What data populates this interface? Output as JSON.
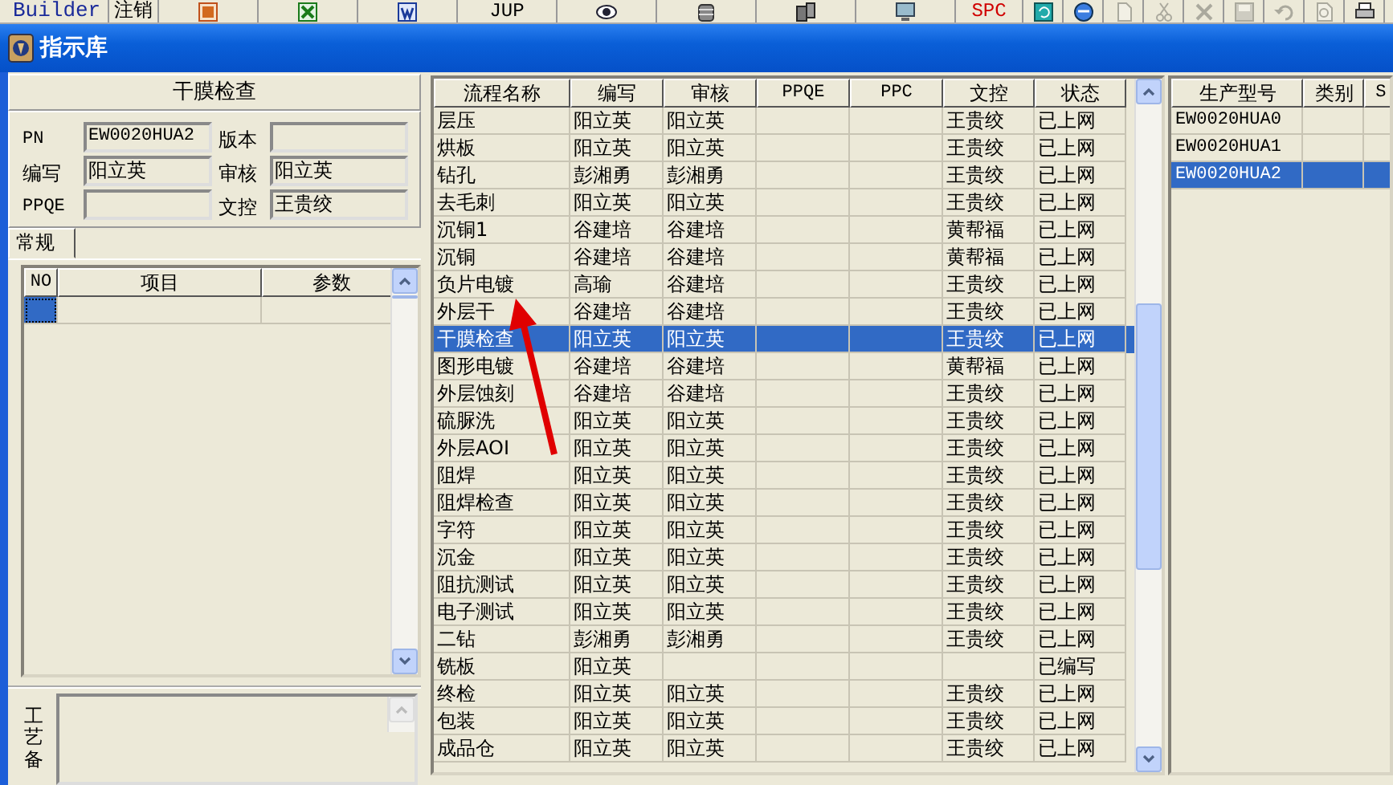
{
  "toolbar": [
    {
      "kind": "text",
      "label": "Builder",
      "disabled": false
    },
    {
      "kind": "text",
      "label": "注销",
      "disabled": false
    },
    {
      "kind": "icon",
      "disabled": false
    },
    {
      "kind": "icon",
      "disabled": false
    },
    {
      "kind": "icon",
      "disabled": false
    },
    {
      "kind": "text",
      "label": "JUP",
      "disabled": false
    },
    {
      "kind": "icon",
      "disabled": false
    },
    {
      "kind": "icon",
      "disabled": false
    },
    {
      "kind": "icon",
      "disabled": false
    },
    {
      "kind": "icon",
      "disabled": false
    },
    {
      "kind": "text",
      "label": "SPC",
      "disabled": false
    },
    {
      "kind": "icon",
      "disabled": false
    },
    {
      "kind": "icon",
      "disabled": false
    },
    {
      "kind": "icon",
      "disabled": true
    },
    {
      "kind": "icon",
      "disabled": true
    },
    {
      "kind": "icon",
      "disabled": true
    },
    {
      "kind": "icon",
      "disabled": true
    },
    {
      "kind": "icon",
      "disabled": true
    },
    {
      "kind": "icon",
      "disabled": true
    },
    {
      "kind": "icon",
      "disabled": false
    }
  ],
  "window": {
    "title": "指示库"
  },
  "detail": {
    "heading": "干膜检查",
    "fields": [
      {
        "label": "PN",
        "value": "EW0020HUA2"
      },
      {
        "label": "版本"
      },
      {
        "label": "编写",
        "value": "阳立英"
      },
      {
        "label": "审核",
        "value": "阳立英"
      },
      {
        "label": "PPQE"
      },
      {
        "label": "文控",
        "value": "王贵绞"
      }
    ],
    "tabs": [
      {
        "label": "常规",
        "selected": true
      }
    ],
    "params_table": {
      "columns": [
        "NO",
        "项目",
        "参数"
      ],
      "rows": [
        {
          "selected": true
        }
      ]
    },
    "notes": {
      "label": "工艺备"
    }
  },
  "process_table": {
    "columns": [
      "流程名称",
      "编写",
      "审核",
      "PPQE",
      "PPC",
      "文控",
      "状态"
    ],
    "rows": [
      {
        "cells": [
          "层压",
          "阳立英",
          "阳立英",
          null,
          null,
          "王贵绞",
          "已上网"
        ],
        "selected": false
      },
      {
        "cells": [
          "烘板",
          "阳立英",
          "阳立英",
          null,
          null,
          "王贵绞",
          "已上网"
        ],
        "selected": false
      },
      {
        "cells": [
          "钻孔",
          "彭湘勇",
          "彭湘勇",
          null,
          null,
          "王贵绞",
          "已上网"
        ],
        "selected": false
      },
      {
        "cells": [
          "去毛刺",
          "阳立英",
          "阳立英",
          null,
          null,
          "王贵绞",
          "已上网"
        ],
        "selected": false
      },
      {
        "cells": [
          "沉铜1",
          "谷建培",
          "谷建培",
          null,
          null,
          "黄帮福",
          "已上网"
        ],
        "selected": false
      },
      {
        "cells": [
          "沉铜",
          "谷建培",
          "谷建培",
          null,
          null,
          "黄帮福",
          "已上网"
        ],
        "selected": false
      },
      {
        "cells": [
          "负片电镀",
          "高瑜",
          "谷建培",
          null,
          null,
          "王贵绞",
          "已上网"
        ],
        "selected": false
      },
      {
        "cells": [
          "外层干",
          "谷建培",
          "谷建培",
          null,
          null,
          "王贵绞",
          "已上网"
        ],
        "selected": false
      },
      {
        "cells": [
          "干膜检查",
          "阳立英",
          "阳立英",
          null,
          null,
          "王贵绞",
          "已上网"
        ],
        "selected": true
      },
      {
        "cells": [
          "图形电镀",
          "谷建培",
          "谷建培",
          null,
          null,
          "黄帮福",
          "已上网"
        ],
        "selected": false
      },
      {
        "cells": [
          "外层蚀刻",
          "谷建培",
          "谷建培",
          null,
          null,
          "王贵绞",
          "已上网"
        ],
        "selected": false
      },
      {
        "cells": [
          "硫脲洗",
          "阳立英",
          "阳立英",
          null,
          null,
          "王贵绞",
          "已上网"
        ],
        "selected": false
      },
      {
        "cells": [
          "外层AOI",
          "阳立英",
          "阳立英",
          null,
          null,
          "王贵绞",
          "已上网"
        ],
        "selected": false
      },
      {
        "cells": [
          "阻焊",
          "阳立英",
          "阳立英",
          null,
          null,
          "王贵绞",
          "已上网"
        ],
        "selected": false
      },
      {
        "cells": [
          "阻焊检查",
          "阳立英",
          "阳立英",
          null,
          null,
          "王贵绞",
          "已上网"
        ],
        "selected": false
      },
      {
        "cells": [
          "字符",
          "阳立英",
          "阳立英",
          null,
          null,
          "王贵绞",
          "已上网"
        ],
        "selected": false
      },
      {
        "cells": [
          "沉金",
          "阳立英",
          "阳立英",
          null,
          null,
          "王贵绞",
          "已上网"
        ],
        "selected": false
      },
      {
        "cells": [
          "阻抗测试",
          "阳立英",
          "阳立英",
          null,
          null,
          "王贵绞",
          "已上网"
        ],
        "selected": false
      },
      {
        "cells": [
          "电子测试",
          "阳立英",
          "阳立英",
          null,
          null,
          "王贵绞",
          "已上网"
        ],
        "selected": false
      },
      {
        "cells": [
          "二钻",
          "彭湘勇",
          "彭湘勇",
          null,
          null,
          "王贵绞",
          "已上网"
        ],
        "selected": false
      },
      {
        "cells": [
          "铣板",
          "阳立英",
          null,
          null,
          null,
          null,
          "已编写"
        ],
        "selected": false
      },
      {
        "cells": [
          "终检",
          "阳立英",
          "阳立英",
          null,
          null,
          "王贵绞",
          "已上网"
        ],
        "selected": false
      },
      {
        "cells": [
          "包装",
          "阳立英",
          "阳立英",
          null,
          null,
          "王贵绞",
          "已上网"
        ],
        "selected": false
      },
      {
        "cells": [
          "成品仓",
          "阳立英",
          "阳立英",
          null,
          null,
          "王贵绞",
          "已上网"
        ],
        "selected": false
      }
    ]
  },
  "model_table": {
    "columns": [
      "生产型号",
      "类别",
      "S"
    ],
    "rows": [
      {
        "cells": [
          "EW0020HUA0"
        ],
        "selected": false
      },
      {
        "cells": [
          "EW0020HUA1"
        ],
        "selected": false
      },
      {
        "cells": [
          "EW0020HUA2"
        ],
        "selected": true
      }
    ]
  }
}
